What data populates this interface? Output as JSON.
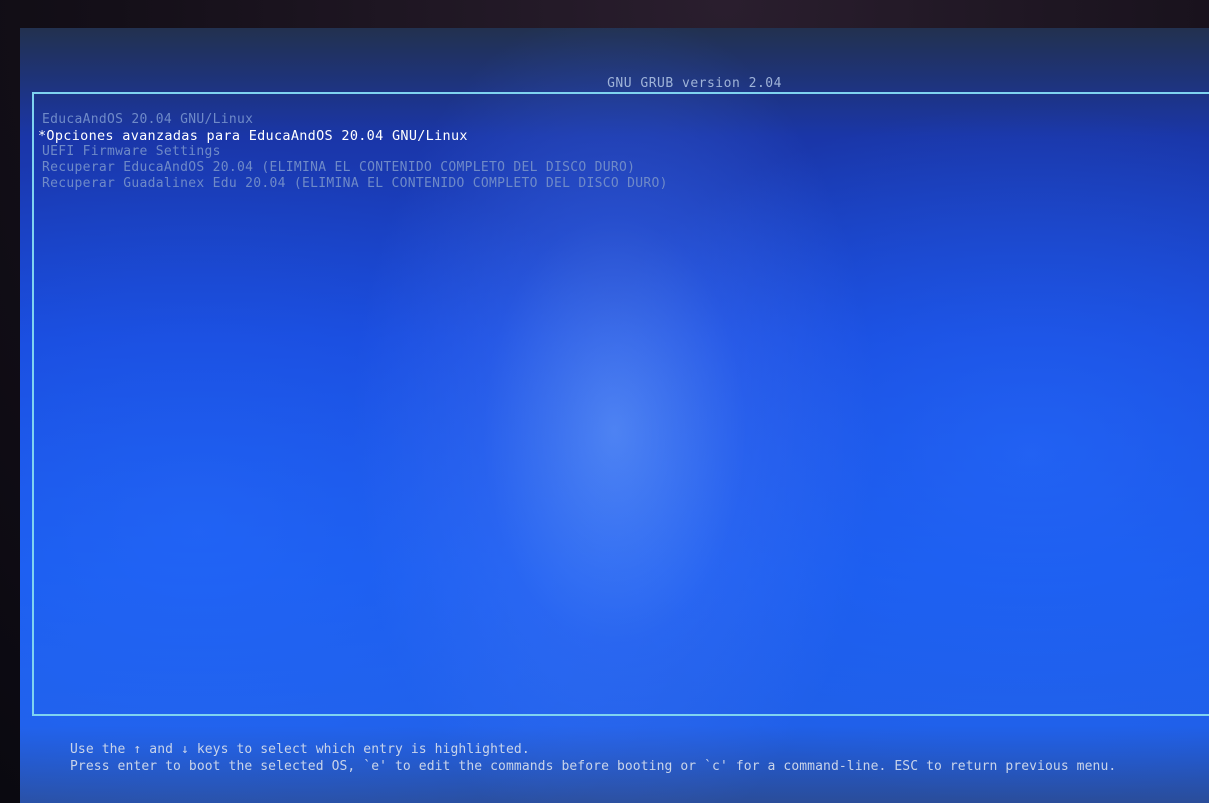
{
  "header": {
    "title": "GNU GRUB  version 2.04"
  },
  "menu": {
    "entries": [
      {
        "label": "EducaAndOS 20.04 GNU/Linux",
        "selected": false
      },
      {
        "label": "*Opciones avanzadas para EducaAndOS 20.04 GNU/Linux",
        "selected": true
      },
      {
        "label": "UEFI Firmware Settings",
        "selected": false
      },
      {
        "label": "Recuperar EducaAndOS 20.04 (ELIMINA EL CONTENIDO COMPLETO DEL DISCO DURO)",
        "selected": false
      },
      {
        "label": "Recuperar Guadalinex Edu 20.04 (ELIMINA EL CONTENIDO COMPLETO DEL DISCO DURO)",
        "selected": false
      }
    ]
  },
  "footer": {
    "line1": "Use the ↑ and ↓ keys to select which entry is highlighted.",
    "line2": "Press enter to boot the selected OS, `e' to edit the commands before booting or `c' for a command-line. ESC to return previous menu."
  },
  "colors": {
    "border": "#7fd3f0",
    "selected_text": "#ffffff",
    "normal_text": "#6f8ac8",
    "background": "#1746d8"
  }
}
